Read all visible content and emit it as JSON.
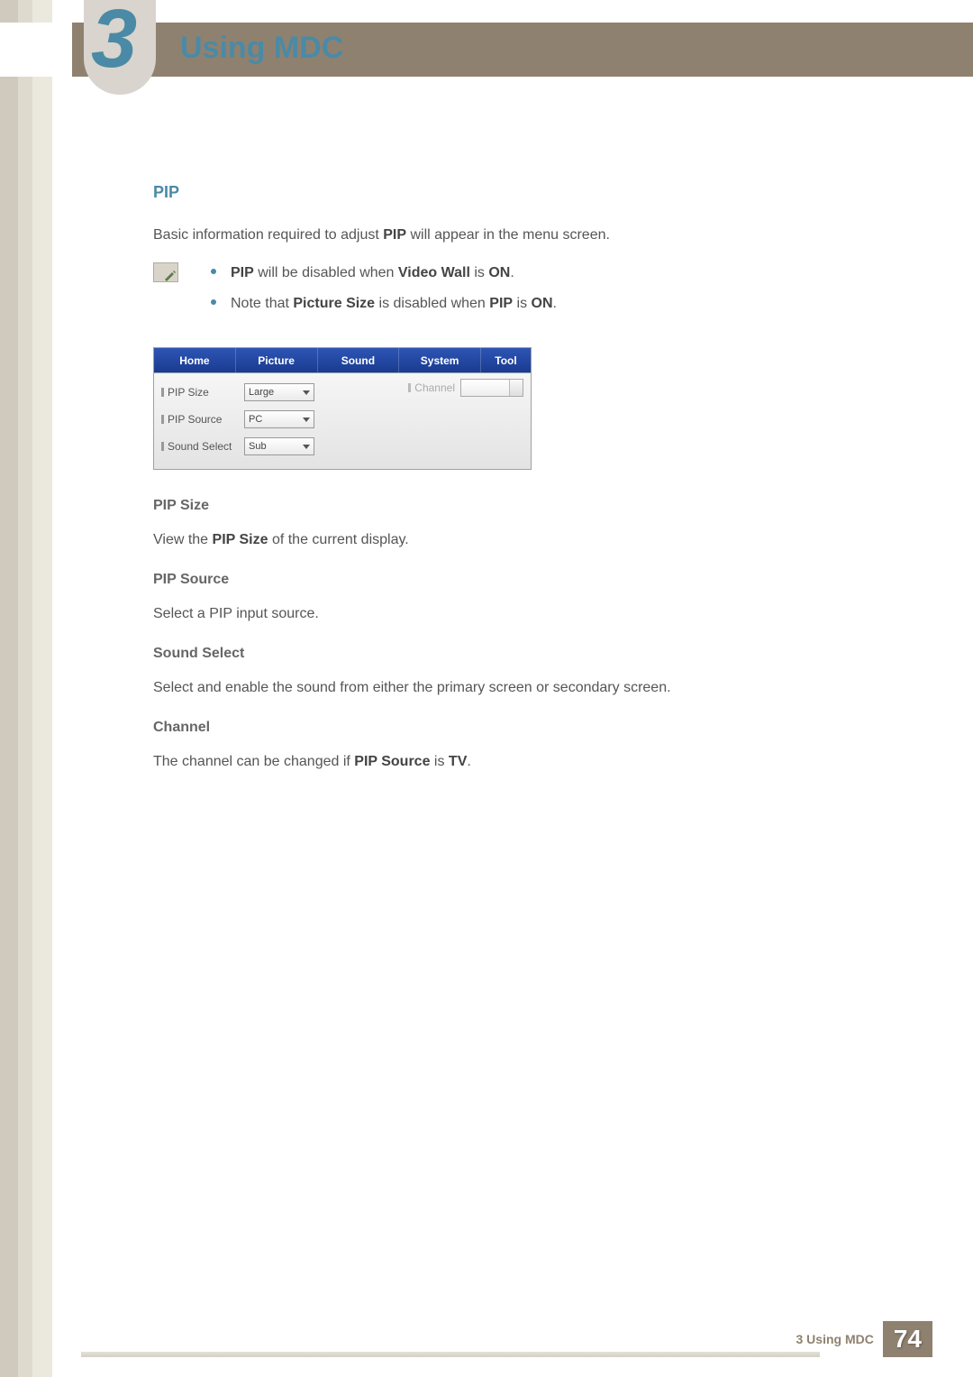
{
  "chapter": {
    "number": "3",
    "title": "Using MDC"
  },
  "section": {
    "heading": "PIP"
  },
  "intro": {
    "pre": "Basic information required to adjust ",
    "bold": "PIP",
    "post": " will appear in the menu screen."
  },
  "notes": [
    {
      "b1": "PIP",
      "mid1": " will be disabled when ",
      "b2": "Video Wall",
      "mid2": " is ",
      "b3": "ON",
      "post": "."
    },
    {
      "pre": "Note that ",
      "b1": "Picture Size",
      "mid1": " is disabled when ",
      "b2": "PIP",
      "mid2": " is ",
      "b3": "ON",
      "post": "."
    }
  ],
  "ui": {
    "tabs": [
      "Home",
      "Picture",
      "Sound",
      "System",
      "Tool"
    ],
    "rows": [
      {
        "label": "PIP Size",
        "value": "Large"
      },
      {
        "label": "PIP Source",
        "value": "PC"
      },
      {
        "label": "Sound Select",
        "value": "Sub"
      }
    ],
    "channel_label": "Channel",
    "channel_value": ""
  },
  "subsections": [
    {
      "title": "PIP Size",
      "pre": "View the ",
      "b1": "PIP Size",
      "post": " of the current display."
    },
    {
      "title": "PIP Source",
      "text": "Select a PIP input source."
    },
    {
      "title": "Sound Select",
      "text": "Select and enable the sound from either the primary screen or secondary screen."
    },
    {
      "title": "Channel",
      "pre": "The channel can be changed if ",
      "b1": "PIP Source",
      "mid": " is ",
      "b2": "TV",
      "post": "."
    }
  ],
  "footer": {
    "label": "3 Using MDC",
    "page": "74"
  }
}
